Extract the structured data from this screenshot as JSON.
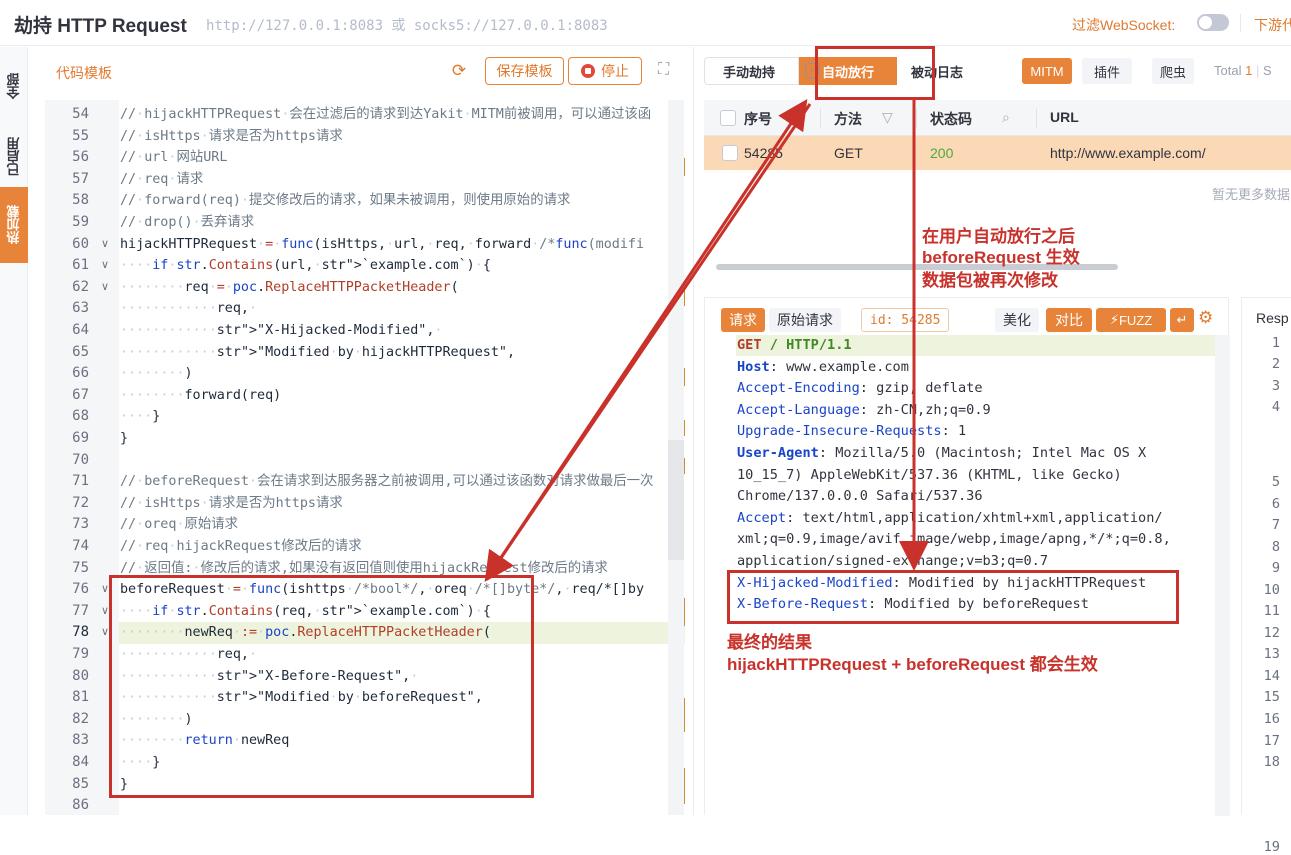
{
  "header": {
    "title": "劫持 HTTP Request",
    "proxy_address": "http://127.0.0.1:8083 或 socks5://127.0.0.1:8083",
    "filter_websocket_label": "过滤WebSocket:",
    "filter_websocket_on": false,
    "download_label": "下游代"
  },
  "side_tabs": [
    {
      "label": "全部",
      "active": false
    },
    {
      "label": "已启用",
      "active": false
    },
    {
      "label": "热加载",
      "active": true
    }
  ],
  "code_panel": {
    "title": "代码模板",
    "reload_icon": "reload-icon",
    "save_template_label": "保存模板",
    "stop_label": "停止",
    "expand_icon": "expand-icon",
    "current_line": 78,
    "lines": [
      {
        "n": 54,
        "text": "//·hijackHTTPRequest·会在过滤后的请求到达Yakit·MITM前被调用，可以通过该函"
      },
      {
        "n": 55,
        "text": "//·isHttps·请求是否为https请求"
      },
      {
        "n": 56,
        "text": "//·url·网站URL"
      },
      {
        "n": 57,
        "text": "//·req·请求"
      },
      {
        "n": 58,
        "text": "//·forward(req)·提交修改后的请求，如果未被调用，则使用原始的请求"
      },
      {
        "n": 59,
        "text": "//·drop()·丢弃请求"
      },
      {
        "n": 60,
        "text": "hijackHTTPRequest·=·func(isHttps,·url,·req,·forward·/*func(modifi"
      },
      {
        "n": 61,
        "text": "····if·str.Contains(url,·`example.com`)·{"
      },
      {
        "n": 62,
        "text": "········req·=·poc.ReplaceHTTPPacketHeader("
      },
      {
        "n": 63,
        "text": "············req,·"
      },
      {
        "n": 64,
        "text": "············\"X-Hijacked-Modified\",·"
      },
      {
        "n": 65,
        "text": "············\"Modified·by·hijackHTTPRequest\","
      },
      {
        "n": 66,
        "text": "········)"
      },
      {
        "n": 67,
        "text": "········forward(req)"
      },
      {
        "n": 68,
        "text": "····}"
      },
      {
        "n": 69,
        "text": "}"
      },
      {
        "n": 70,
        "text": ""
      },
      {
        "n": 71,
        "text": "//·beforeRequest·会在请求到达服务器之前被调用,可以通过该函数对请求做最后一次"
      },
      {
        "n": 72,
        "text": "//·isHttps·请求是否为https请求"
      },
      {
        "n": 73,
        "text": "//·oreq·原始请求"
      },
      {
        "n": 74,
        "text": "//·req·hijackRequest修改后的请求"
      },
      {
        "n": 75,
        "text": "//·返回值:·修改后的请求,如果没有返回值则使用hijackRequest修改后的请求"
      },
      {
        "n": 76,
        "text": "beforeRequest·=·func(ishttps·/*bool*/,·oreq·/*[]byte*/,·req/*[]by"
      },
      {
        "n": 77,
        "text": "····if·str.Contains(req,·`example.com`)·{"
      },
      {
        "n": 78,
        "text": "········newReq·:=·poc.ReplaceHTTPPacketHeader("
      },
      {
        "n": 79,
        "text": "············req,·"
      },
      {
        "n": 80,
        "text": "············\"X-Before-Request\",·"
      },
      {
        "n": 81,
        "text": "············\"Modified·by·beforeRequest\","
      },
      {
        "n": 82,
        "text": "········)"
      },
      {
        "n": 83,
        "text": "········return·newReq"
      },
      {
        "n": 84,
        "text": "····}"
      },
      {
        "n": 85,
        "text": "}"
      },
      {
        "n": 86,
        "text": ""
      }
    ]
  },
  "tabs": {
    "manual": "手动劫持",
    "auto": "自动放行",
    "passive": "被动日志",
    "mitm": "MITM",
    "plugin": "插件",
    "crawler": "爬虫",
    "total_label": "Total",
    "total_value": "1",
    "total_extra": "S"
  },
  "table": {
    "columns": [
      "序号",
      "方法",
      "状态码",
      "URL"
    ],
    "rows": [
      {
        "id": "54285",
        "method": "GET",
        "status": "200",
        "url": "http://www.example.com/"
      }
    ],
    "no_more": "暂无更多数据"
  },
  "request_panel": {
    "tab_request": "请求",
    "tab_original": "原始请求",
    "id_label": "id: 54285",
    "beautify": "美化",
    "compare": "对比",
    "fuzz": "FUZZ",
    "lines": [
      {
        "k": "GET",
        "v": " / HTTP/1.1",
        "type": "start"
      },
      {
        "k": "Host",
        "v": ": www.example.com",
        "type": "bold"
      },
      {
        "k": "Accept-Encoding",
        "v": ": gzip, deflate",
        "type": "h"
      },
      {
        "k": "Accept-Language",
        "v": ": zh-CN,zh;q=0.9",
        "type": "h"
      },
      {
        "k": "Upgrade-Insecure-Requests",
        "v": ": 1",
        "type": "h"
      },
      {
        "k": "User-Agent",
        "v": ": Mozilla/5.0 (Macintosh; Intel Mac OS X",
        "type": "bold"
      },
      {
        "k": "",
        "v": "10_15_7) AppleWebKit/537.36 (KHTML, like Gecko)",
        "type": "cont"
      },
      {
        "k": "",
        "v": "Chrome/137.0.0.0 Safari/537.36",
        "type": "cont"
      },
      {
        "k": "Accept",
        "v": ": text/html,application/xhtml+xml,application/",
        "type": "h"
      },
      {
        "k": "",
        "v": "xml;q=0.9,image/avif,image/webp,image/apng,*/*;q=0.8,",
        "type": "cont"
      },
      {
        "k": "",
        "v": "application/signed-exchange;v=b3;q=0.7",
        "type": "cont"
      },
      {
        "k": "X-Hijacked-Modified",
        "v": ": Modified by hijackHTTPRequest",
        "type": "h"
      },
      {
        "k": "X-Before-Request",
        "v": ": Modified by beforeRequest",
        "type": "h"
      }
    ]
  },
  "response_panel": {
    "label": "Resp",
    "line_numbers": [
      "1",
      "2",
      "3",
      "4",
      "5",
      "6",
      "7",
      "8",
      "9",
      "10",
      "11",
      "12",
      "13",
      "14",
      "15",
      "16",
      "17",
      "18",
      "19"
    ]
  },
  "annotations": {
    "after_auto": [
      "在用户自动放行之后",
      "beforeRequest 生效",
      "数据包被再次修改"
    ],
    "final_result": [
      "最终的结果",
      "hijackHTTPRequest + beforeRequest 都会生效"
    ]
  },
  "colors": {
    "accent": "#e8843a",
    "annotation_red": "#c8322b",
    "selected_row": "#fbd9b6"
  }
}
